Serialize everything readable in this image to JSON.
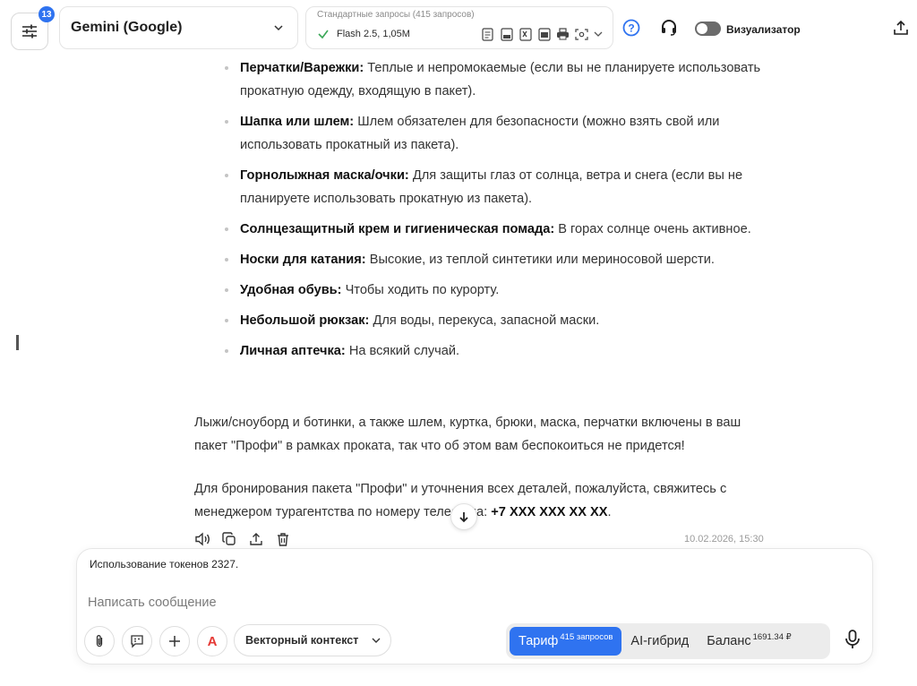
{
  "header": {
    "settings_badge": "13",
    "model_name": "Gemini (Google)",
    "mode_caption": "Стандартные запросы (415 запросов)",
    "mode_value": "Flash 2.5, 1,05M",
    "format_icons": [
      "document-icon",
      "pdf-icon",
      "excel-icon",
      "docx-icon",
      "print-icon",
      "screenshot-icon"
    ],
    "visualizer_label": "Визуализатор",
    "visualizer_enabled": false,
    "accent_color": "#2f73f0"
  },
  "content": {
    "bullets": [
      {
        "term": "Перчатки/Варежки:",
        "text": " Теплые и непромокаемые (если вы не планируете использовать прокатную одежду, входящую в пакет)."
      },
      {
        "term": "Шапка или шлем:",
        "text": " Шлем обязателен для безопасности (можно взять свой или использовать прокатный из пакета)."
      },
      {
        "term": "Горнолыжная маска/очки:",
        "text": " Для защиты глаз от солнца, ветра и снега (если вы не планируете использовать прокатную из пакета)."
      },
      {
        "term": "Солнцезащитный крем и гигиеническая помада:",
        "text": " В горах солнце очень активное."
      },
      {
        "term": "Носки для катания:",
        "text": " Высокие, из теплой синтетики или мериносовой шерсти."
      },
      {
        "term": "Удобная обувь:",
        "text": " Чтобы ходить по курорту."
      },
      {
        "term": "Небольшой рюкзак:",
        "text": " Для воды, перекуса, запасной маски."
      },
      {
        "term": "Личная аптечка:",
        "text": " На всякий случай."
      }
    ],
    "paragraph1": "Лыжи/сноуборд и ботинки, а также шлем, куртка, брюки, маска, перчатки включены в ваш пакет \"Профи\" в рамках проката, так что об этом вам беспокоиться не придется!",
    "paragraph2_text": "Для бронирования пакета \"Профи\" и уточнения всех деталей, пожалуйста, свяжитесь с менеджером турагентства по номеру телефона: ",
    "paragraph2_phone": "+7 XXX XXX XX XX",
    "paragraph2_end": ".",
    "timestamp": "10.02.2026, 15:30"
  },
  "composer": {
    "token_usage": "Использование токенов 2327.",
    "placeholder": "Написать сообщение",
    "value": "",
    "vector_context_label": "Векторный контекст",
    "plan": {
      "tariff_label": "Тариф",
      "tariff_sup": "415 запросов",
      "hybrid_label": "AI-гибрид",
      "balance_label": "Баланс",
      "balance_sup": "1691.34 ₽"
    }
  }
}
